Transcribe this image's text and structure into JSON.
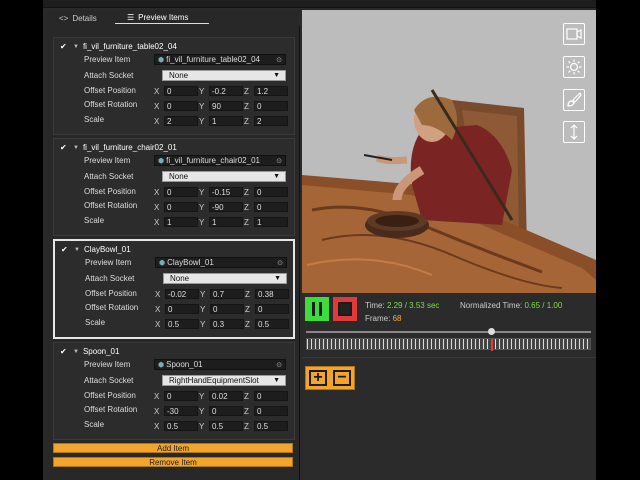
{
  "tabs": [
    {
      "label": "Details",
      "icon": "code-icon"
    },
    {
      "label": "Preview Items",
      "icon": "list-icon"
    }
  ],
  "labels": {
    "preview_item": "Preview Item",
    "attach_socket": "Attach Socket",
    "offset_position": "Offset Position",
    "offset_rotation": "Offset Rotation",
    "scale": "Scale",
    "x": "X",
    "y": "Y",
    "z": "Z"
  },
  "items": [
    {
      "name": "fi_vil_furniture_table02_04",
      "preview": "fi_vil_furniture_table02_04",
      "socket": "None",
      "pos": [
        "0",
        "-0.2",
        "1.2"
      ],
      "rot": [
        "0",
        "90",
        "0"
      ],
      "scale": [
        "2",
        "1",
        "2"
      ]
    },
    {
      "name": "fi_vil_furniture_chair02_01",
      "preview": "fi_vil_furniture_chair02_01",
      "socket": "None",
      "pos": [
        "0",
        "-0.15",
        "0"
      ],
      "rot": [
        "0",
        "-90",
        "0"
      ],
      "scale": [
        "1",
        "1",
        "1"
      ]
    },
    {
      "name": "ClayBowl_01",
      "preview": "ClayBowl_01",
      "socket": "None",
      "pos": [
        "-0.02",
        "0.7",
        "0.38"
      ],
      "rot": [
        "0",
        "0",
        "0"
      ],
      "scale": [
        "0.5",
        "0.3",
        "0.5"
      ]
    },
    {
      "name": "Spoon_01",
      "preview": "Spoon_01",
      "socket": "RightHandEquipmentSlot",
      "pos": [
        "0",
        "0.02",
        "0"
      ],
      "rot": [
        "-30",
        "0",
        "0"
      ],
      "scale": [
        "0.5",
        "0.5",
        "0.5"
      ]
    }
  ],
  "buttons": {
    "add": "Add Item",
    "remove": "Remove Item"
  },
  "playback": {
    "time_label": "Time:",
    "time_value": "2.29 / 3.53 sec",
    "norm_label": "Normalized Time:",
    "norm_value": "0.65 / 1.00",
    "frame_label": "Frame:",
    "frame_value": "68",
    "progress": 0.65
  },
  "viewport_icons": [
    "camera-icon",
    "sun-icon",
    "brush-icon",
    "resize-vertical-icon"
  ],
  "colors": {
    "accent": "#f2a52a",
    "play": "#3ddc3d",
    "stop": "#e03a3a",
    "value_green": "#7fdc4a"
  }
}
